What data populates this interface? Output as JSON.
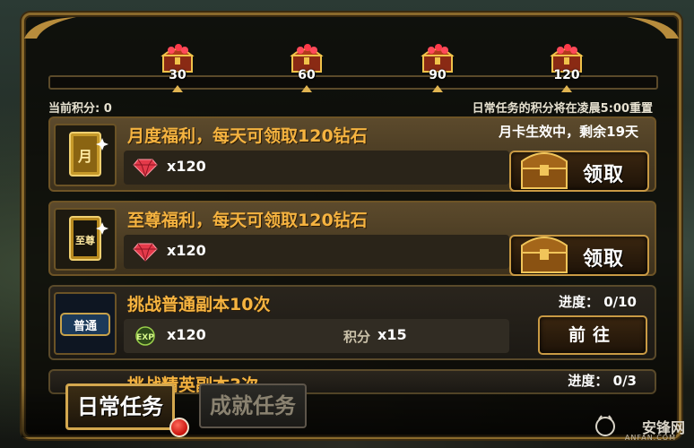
{
  "milestones": [
    {
      "points": "30"
    },
    {
      "points": "60"
    },
    {
      "points": "90"
    },
    {
      "points": "120"
    }
  ],
  "header": {
    "current_score": "当前积分: 0",
    "reset_note": "日常任务的积分将在凌晨5:00重置"
  },
  "tasks": [
    {
      "icon": "monthly-card-icon",
      "icon_text": "月",
      "title": "月度福利，每天可领取120钻石",
      "status": "月卡生效中，剩余19天",
      "reward_icon": "diamond-icon",
      "reward_amount": "x120",
      "button": "领取"
    },
    {
      "icon": "supreme-card-icon",
      "icon_text": "至尊",
      "title": "至尊福利，每天可领取120钻石",
      "reward_icon": "diamond-icon",
      "reward_amount": "x120",
      "button": "领取"
    },
    {
      "icon": "normal-dungeon-icon",
      "icon_text": "普通",
      "title": "挑战普通副本10次",
      "progress": "进度： 0/10",
      "reward_icon": "exp-icon",
      "reward_icon_text": "EXP",
      "reward_amount": "x120",
      "reward2_label": "积分",
      "reward2_amount": "x15",
      "button": "前往"
    },
    {
      "title": "挑战精英副本3次",
      "progress": "进度： 0/3"
    }
  ],
  "tabs": [
    {
      "label": "日常任务",
      "active": true
    },
    {
      "label": "成就任务",
      "active": false
    }
  ],
  "watermark": {
    "name": "安锋网",
    "sub": "ANFAN.COM"
  },
  "colors": {
    "accent_gold": "#f5b340",
    "frame": "#8a6a2c",
    "notification": "#c8120c"
  }
}
